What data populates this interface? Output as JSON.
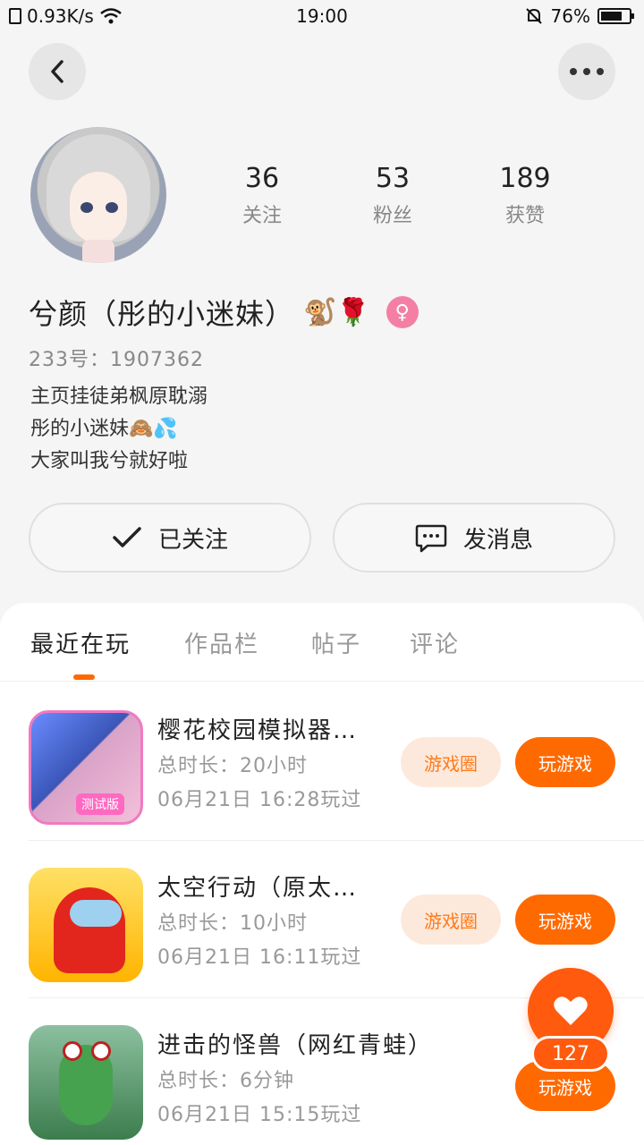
{
  "status_bar": {
    "speed": "0.93K/s",
    "time": "19:00",
    "battery_percent": "76%",
    "battery_level": 0.76
  },
  "profile": {
    "followers_count": "53",
    "following_count": "36",
    "likes_count": "189",
    "following_label": "关注",
    "fans_label": "粉丝",
    "likes_label": "获赞",
    "name": "兮颜（彤的小迷妹）",
    "name_emoji": "🐒🌹",
    "gender_symbol": "♀",
    "uid": "233号：1907362",
    "bio_lines": [
      "主页挂徒弟枫原耽溺",
      "彤的小迷妹🙈💦",
      "大家叫我兮就好啦"
    ]
  },
  "actions": {
    "follow_label": "已关注",
    "message_label": "发消息"
  },
  "tabs": [
    "最近在玩",
    "作品栏",
    "帖子",
    "评论"
  ],
  "games": [
    {
      "title": "樱花校园模拟器…",
      "duration": "总时长：20小时",
      "last_played": "06月21日 16:28玩过",
      "circle_label": "游戏圈",
      "play_label": "玩游戏",
      "icon_badge": "测试版"
    },
    {
      "title": "太空行动（原太…",
      "duration": "总时长：10小时",
      "last_played": "06月21日 16:11玩过",
      "circle_label": "游戏圈",
      "play_label": "玩游戏"
    },
    {
      "title": "进击的怪兽（网红青蛙）",
      "duration": "总时长：6分钟",
      "last_played": "06月21日 15:15玩过",
      "play_label": "玩游戏"
    }
  ],
  "like_fab": {
    "count": "127"
  }
}
